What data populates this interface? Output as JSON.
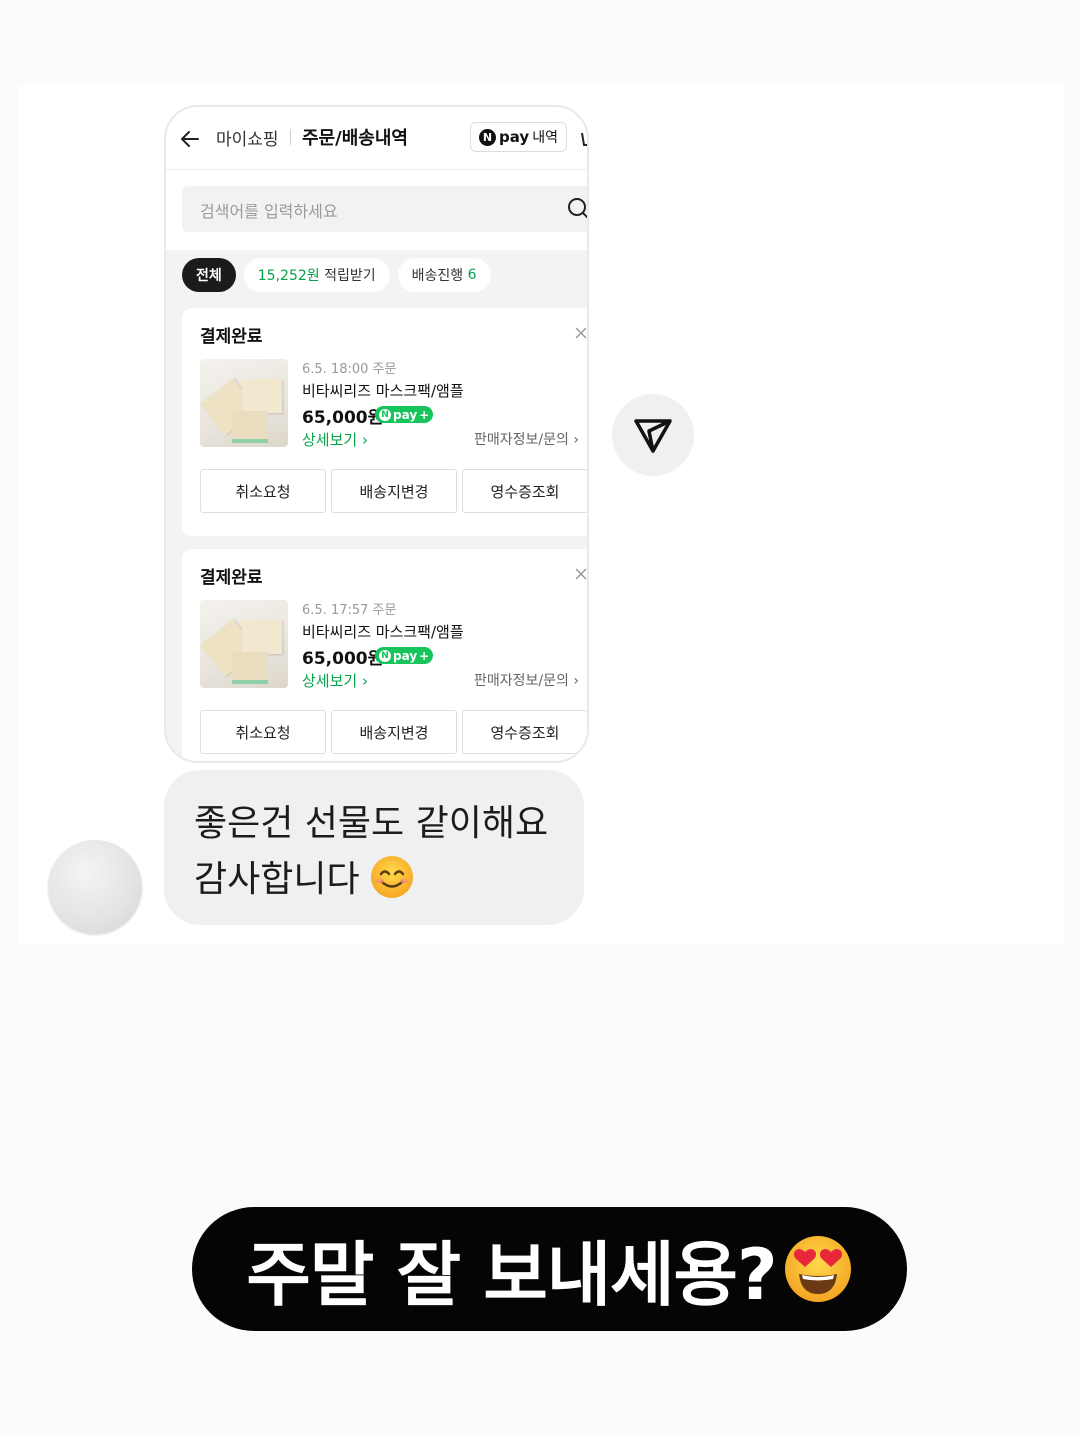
{
  "phone": {
    "breadcrumb_home": "마이쇼핑",
    "title": "주문/배송내역",
    "npay_logo": "N",
    "npay_word": "pay",
    "npay_suffix": "내역",
    "search_placeholder": "검색어를 입력하세요",
    "chips": {
      "all": "전체",
      "points_amount": "15,252원",
      "points_label": "적립받기",
      "shipping_label": "배송진행",
      "shipping_count": "6"
    },
    "orders": [
      {
        "status": "결제완료",
        "date": "6.5. 18:00 주문",
        "product": "비타씨리즈 마스크팩/앰플",
        "price": "65,000원",
        "badge": "pay",
        "detail_link": "상세보기",
        "seller_link": "판매자정보/문의",
        "actions": [
          "취소요청",
          "배송지변경",
          "영수증조회"
        ]
      },
      {
        "status": "결제완료",
        "date": "6.5. 17:57 주문",
        "product": "비타씨리즈 마스크팩/앰플",
        "price": "65,000원",
        "badge": "pay",
        "detail_link": "상세보기",
        "seller_link": "판매자정보/문의",
        "actions": [
          "취소요청",
          "배송지변경",
          "영수증조회"
        ]
      }
    ]
  },
  "message": {
    "line1": "좋은건 선물도 같이해요",
    "line2": "감사합니다",
    "emoji": "smiling-face-icon"
  },
  "caption": {
    "text": "주말 잘 보내세용?",
    "emoji": "heart-eyes-icon"
  },
  "colors": {
    "naver_green": "#06a04a",
    "caption_bg": "#050505",
    "bubble_bg": "#eff0f2"
  }
}
